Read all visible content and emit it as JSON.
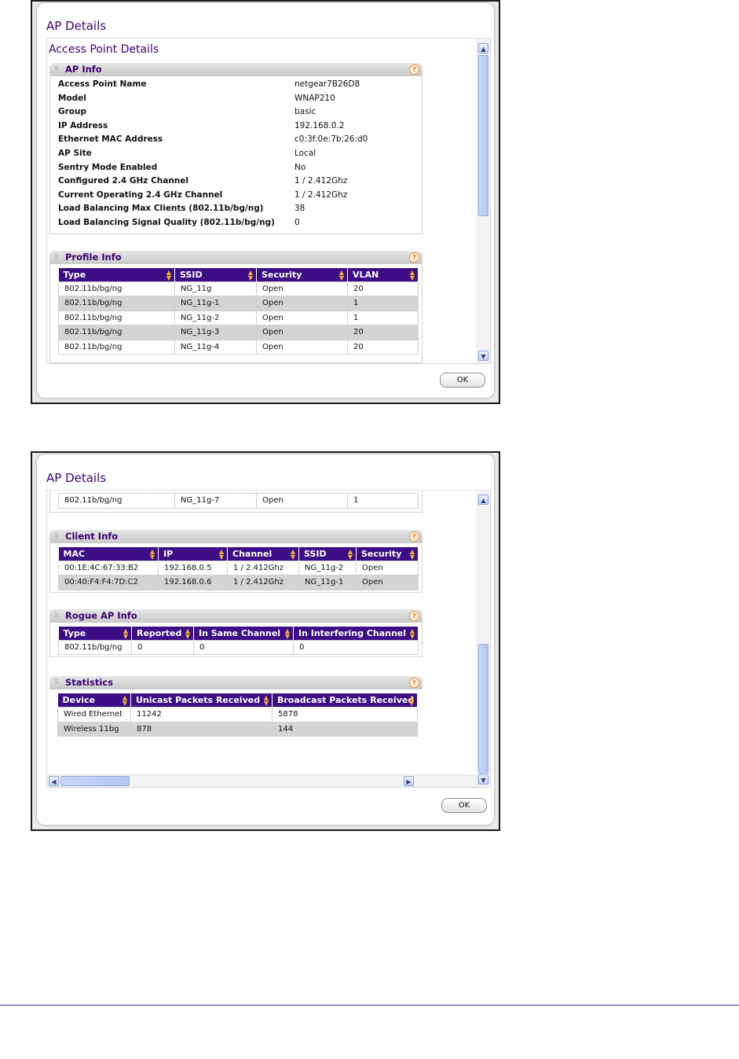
{
  "dialog": {
    "title": "AP Details",
    "ok_label": "OK"
  },
  "section_title": "Access Point Details",
  "ap_info": {
    "title": "AP Info",
    "rows": [
      {
        "label": "Access Point Name",
        "value": "netgear7B26D8"
      },
      {
        "label": "Model",
        "value": "WNAP210"
      },
      {
        "label": "Group",
        "value": "basic"
      },
      {
        "label": "IP Address",
        "value": "192.168.0.2"
      },
      {
        "label": "Ethernet MAC Address",
        "value": "c0:3f:0e:7b:26:d0"
      },
      {
        "label": "AP Site",
        "value": "Local"
      },
      {
        "label": "Sentry Mode Enabled",
        "value": "No"
      },
      {
        "label": "Configured 2.4 GHz Channel",
        "value": "1 / 2.412Ghz"
      },
      {
        "label": "Current Operating 2.4 GHz Channel",
        "value": "1 / 2.412Ghz"
      },
      {
        "label": "Load Balancing Max Clients (802.11b/bg/ng)",
        "value": "38"
      },
      {
        "label": "Load Balancing Signal Quality (802.11b/bg/ng)",
        "value": "0"
      }
    ]
  },
  "profile_info": {
    "title": "Profile Info",
    "headers": [
      "Type",
      "SSID",
      "Security",
      "VLAN"
    ],
    "rows": [
      [
        "802.11b/bg/ng",
        "NG_11g",
        "Open",
        "20"
      ],
      [
        "802.11b/bg/ng",
        "NG_11g-1",
        "Open",
        "1"
      ],
      [
        "802.11b/bg/ng",
        "NG_11g-2",
        "Open",
        "1"
      ],
      [
        "802.11b/bg/ng",
        "NG_11g-3",
        "Open",
        "20"
      ],
      [
        "802.11b/bg/ng",
        "NG_11g-4",
        "Open",
        "20"
      ]
    ],
    "last_row": [
      "802.11b/bg/ng",
      "NG_11g-7",
      "Open",
      "1"
    ]
  },
  "client_info": {
    "title": "Client Info",
    "headers": [
      "MAC",
      "IP",
      "Channel",
      "SSID",
      "Security"
    ],
    "rows": [
      [
        "00:1E:4C:67:33:B2",
        "192.168.0.5",
        "1 / 2.412Ghz",
        "NG_11g-2",
        "Open"
      ],
      [
        "00:40:F4:F4:7D:C2",
        "192.168.0.6",
        "1 / 2.412Ghz",
        "NG_11g-1",
        "Open"
      ]
    ]
  },
  "rogue_ap_info": {
    "title": "Rogue AP Info",
    "headers": [
      "Type",
      "Reported",
      "In Same Channel",
      "In Interfering Channel"
    ],
    "rows": [
      [
        "802.11b/bg/ng",
        "0",
        "0",
        "0"
      ]
    ]
  },
  "statistics": {
    "title": "Statistics",
    "headers": [
      "Device",
      "Unicast Packets Received",
      "Broadcast Packets Received"
    ],
    "rows": [
      [
        "Wired Ethernet",
        "11242",
        "5878"
      ],
      [
        "Wireless 11bg",
        "878",
        "144"
      ]
    ]
  },
  "icons": {
    "help": "help-icon",
    "grip": "drag-grip-icon",
    "sort": "sort-icon",
    "up": "scroll-up-arrow-icon",
    "down": "scroll-down-arrow-icon",
    "left": "scroll-left-arrow-icon",
    "right": "scroll-right-arrow-icon"
  },
  "colors": {
    "title": "#3a006f",
    "table_header": "#3d0d86",
    "sort_arrow": "#f2b13a",
    "help": "#f08a2a",
    "alt_row": "#d4d4d4"
  }
}
